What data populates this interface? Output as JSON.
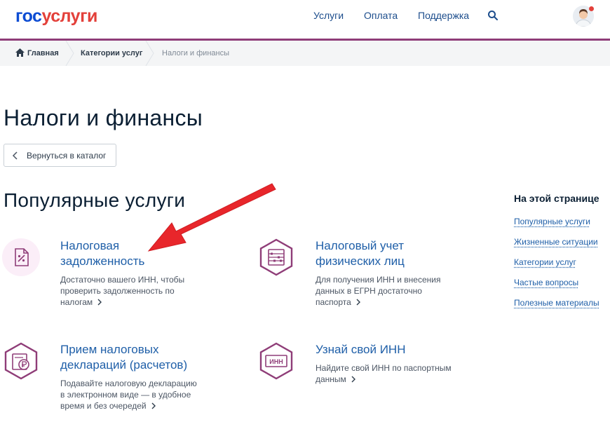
{
  "header": {
    "logo_part1": "гос",
    "logo_part2": "услуги",
    "nav": [
      "Услуги",
      "Оплата",
      "Поддержка"
    ],
    "search_icon": "search-icon",
    "avatar_icon": "user-avatar"
  },
  "breadcrumb": {
    "items": [
      "Главная",
      "Категории услуг",
      "Налоги и финансы"
    ]
  },
  "page": {
    "title": "Налоги и финансы",
    "back_label": "Вернуться в каталог",
    "section_title": "Популярные услуги"
  },
  "services": [
    {
      "title_line1": "Налоговая",
      "title_line2": "задолженность",
      "desc": [
        "Достаточно вашего ИНН, чтобы",
        "проверить задолженность по",
        "налогам"
      ],
      "icon": "tax-percent-document-icon"
    },
    {
      "title_line1": "Налоговый учет",
      "title_line2": "физических лиц",
      "desc": [
        "Для получения ИНН и внесения",
        "данных в ЕГРН достаточно",
        "паспорта"
      ],
      "icon": "abacus-icon"
    },
    {
      "title_line1": "Прием налоговых",
      "title_line2": "деклараций (расчетов)",
      "desc": [
        "Подавайте налоговую декларацию",
        "в электронном виде — в удобное",
        "время и без очередей"
      ],
      "icon": "ruble-declaration-icon"
    },
    {
      "title_line1": "Узнай свой ИНН",
      "title_line2": "",
      "desc": [
        "Найдите свой ИНН по паспортным",
        "данным"
      ],
      "icon": "inn-card-icon",
      "icon_text": "ИНН"
    }
  ],
  "toc": {
    "title": "На этой странице",
    "links": [
      "Популярные услуги",
      "Жизненные ситуации",
      "Категории услуг",
      "Частые вопросы",
      "Полезные материалы"
    ]
  },
  "colors": {
    "brand_blue": "#0d4cd3",
    "brand_red": "#e3403a",
    "accent_purple": "#8f3d78",
    "link_blue": "#1f5fa8",
    "annotation_red": "#e8262b"
  }
}
